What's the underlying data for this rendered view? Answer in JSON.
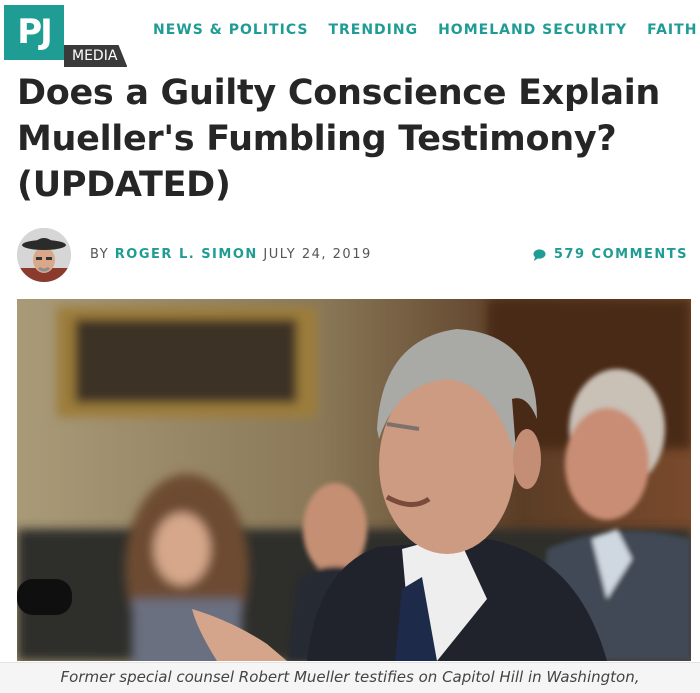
{
  "header": {
    "logo_text": "PJ",
    "logo_sub": "MEDIA",
    "nav": [
      "NEWS & POLITICS",
      "TRENDING",
      "HOMELAND SECURITY",
      "FAITH"
    ]
  },
  "article": {
    "headline": "Does a Guilty Conscience Explain Mueller's Fumbling Testimony? (UPDATED)",
    "byline_prefix": "BY",
    "author": "ROGER L. SIMON",
    "date": "JULY 24, 2019",
    "comments": "579 COMMENTS",
    "caption": "Former special counsel Robert Mueller testifies on Capitol Hill in Washington,"
  },
  "colors": {
    "accent": "#1f9c94",
    "headline": "#262626"
  }
}
